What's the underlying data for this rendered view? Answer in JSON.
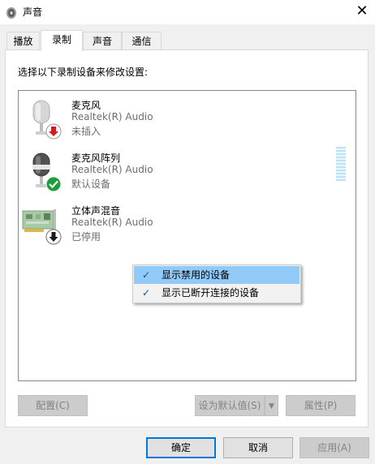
{
  "window": {
    "title": "声音",
    "close_glyph": "✕"
  },
  "tabs": [
    {
      "label": "播放",
      "active": false
    },
    {
      "label": "录制",
      "active": true
    },
    {
      "label": "声音",
      "active": false
    },
    {
      "label": "通信",
      "active": false
    }
  ],
  "instruction": "选择以下录制设备来修改设置:",
  "devices": [
    {
      "name": "麦克风",
      "driver": "Realtek(R) Audio",
      "status": "未插入",
      "icon": "microphone-icon",
      "badge": "unplugged-red-arrow-icon"
    },
    {
      "name": "麦克风阵列",
      "driver": "Realtek(R) Audio",
      "status": "默认设备",
      "icon": "microphone-icon",
      "badge": "default-green-check-icon"
    },
    {
      "name": "立体声混音",
      "driver": "Realtek(R) Audio",
      "status": "已停用",
      "icon": "sound-card-icon",
      "badge": "disabled-down-arrow-icon"
    }
  ],
  "context_menu": [
    {
      "label": "显示禁用的设备",
      "checked": true,
      "highlighted": true
    },
    {
      "label": "显示已断开连接的设备",
      "checked": true,
      "highlighted": false
    }
  ],
  "buttons": {
    "configure": "配置(C)",
    "set_default": "设为默认值(S)",
    "properties": "属性(P)",
    "ok": "确定",
    "cancel": "取消",
    "apply": "应用(A)"
  },
  "colors": {
    "accent": "#0078d7",
    "menu_highlight": "#91c9f7",
    "default_check": "#1e9e3a",
    "unplugged": "#d71920"
  }
}
